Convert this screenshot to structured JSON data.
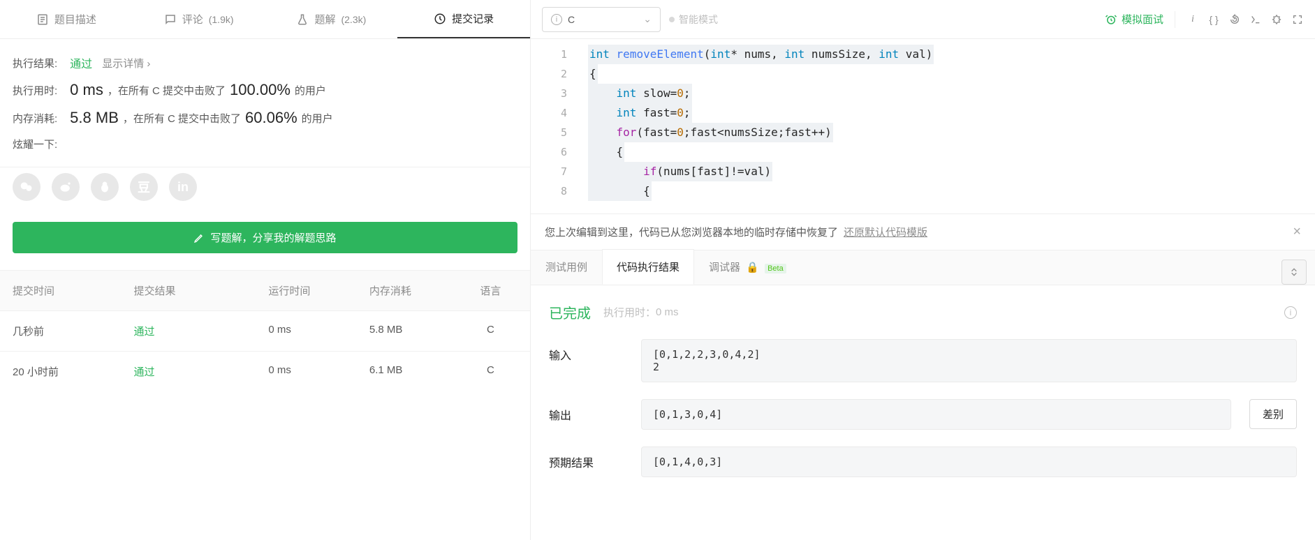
{
  "left_tabs": [
    {
      "label": "题目描述",
      "count": ""
    },
    {
      "label": "评论",
      "count": "(1.9k)"
    },
    {
      "label": "题解",
      "count": "(2.3k)"
    },
    {
      "label": "提交记录",
      "count": ""
    }
  ],
  "result": {
    "label": "执行结果:",
    "status": "通过",
    "detail": "显示详情 ›",
    "time_label": "执行用时:",
    "time_value": "0 ms",
    "time_desc1": "，在所有 C 提交中击败了",
    "time_pct": "100.00%",
    "time_desc2": " 的用户",
    "mem_label": "内存消耗:",
    "mem_value": "5.8 MB",
    "mem_desc1": "，在所有 C 提交中击败了",
    "mem_pct": "60.06%",
    "mem_desc2": " 的用户",
    "brag": "炫耀一下:"
  },
  "share_button": "写题解，分享我的解题思路",
  "history": {
    "headers": [
      "提交时间",
      "提交结果",
      "运行时间",
      "内存消耗",
      "语言"
    ],
    "rows": [
      {
        "time": "几秒前",
        "result": "通过",
        "runtime": "0 ms",
        "memory": "5.8 MB",
        "lang": "C"
      },
      {
        "time": "20 小时前",
        "result": "通过",
        "runtime": "0 ms",
        "memory": "6.1 MB",
        "lang": "C"
      }
    ]
  },
  "toolbar": {
    "lang": "C",
    "mode": "智能模式",
    "mock": "模拟面试"
  },
  "code_lines": [
    "int removeElement(int* nums, int numsSize, int val)",
    "{",
    "    int slow=0;",
    "    int fast=0;",
    "    for(fast=0;fast<numsSize;fast++)",
    "    {",
    "        if(nums[fast]!=val)",
    "        {"
  ],
  "notice": {
    "text": "您上次编辑到这里，代码已从您浏览器本地的临时存储中恢复了",
    "link": "还原默认代码模版"
  },
  "result_tabs": [
    "测试用例",
    "代码执行结果",
    "调试器"
  ],
  "beta": "Beta",
  "run_result": {
    "status": "已完成",
    "time_label": "执行用时：",
    "time": "0 ms",
    "input_label": "输入",
    "input": "[0,1,2,2,3,0,4,2]\n2",
    "output_label": "输出",
    "output": "[0,1,3,0,4]",
    "expected_label": "预期结果",
    "expected": "[0,1,4,0,3]",
    "diff": "差别"
  }
}
